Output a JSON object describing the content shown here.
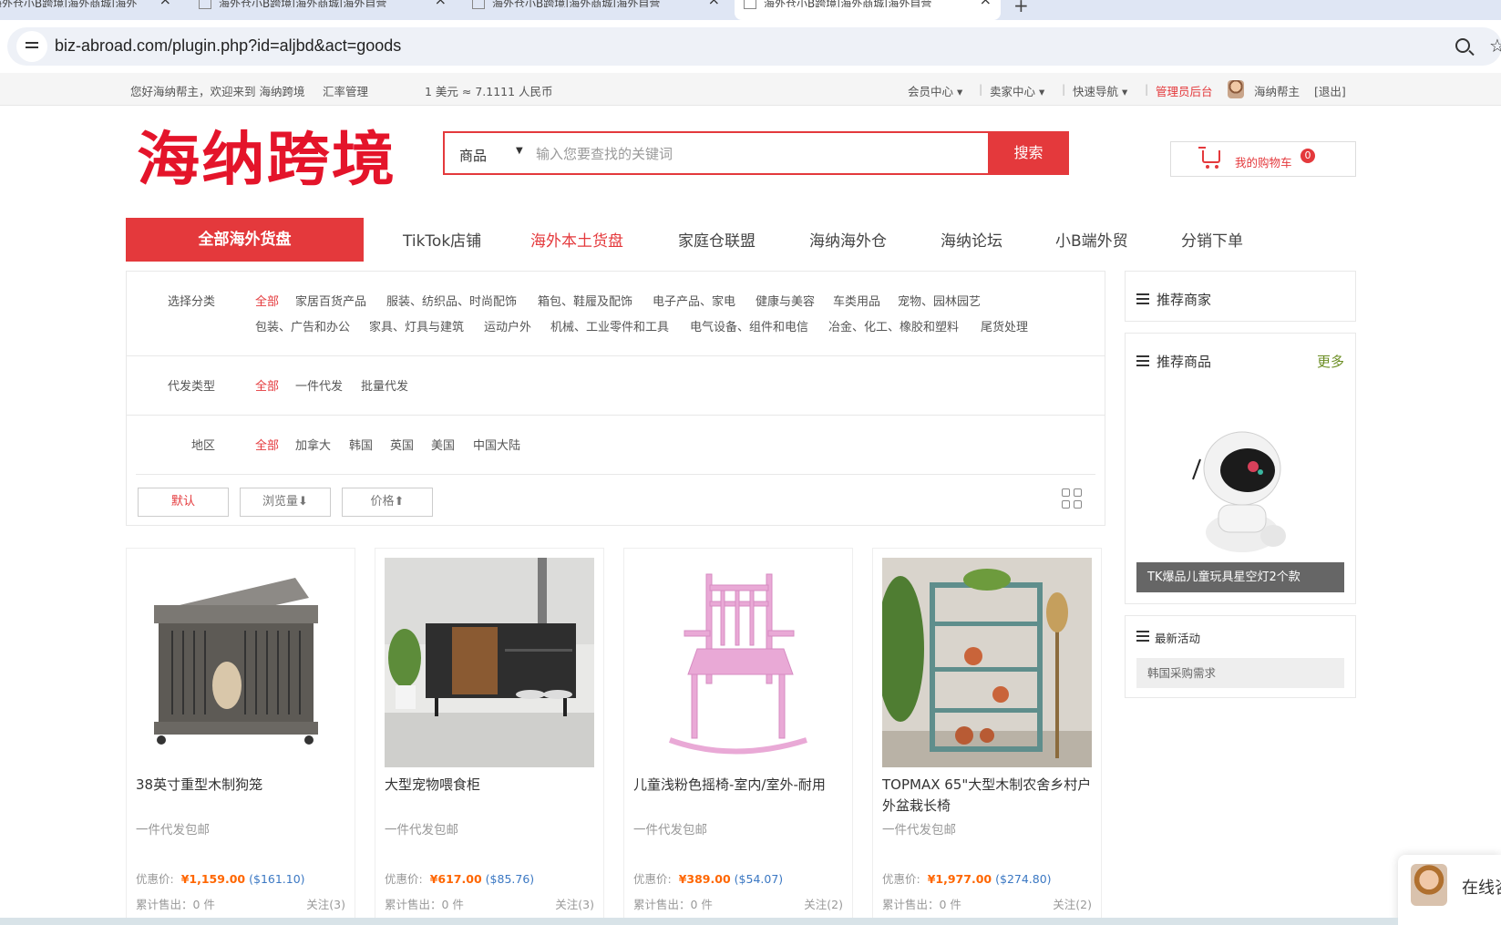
{
  "browser": {
    "tabs": [
      {
        "title": "海外仓小B跨境|海外商城|海外"
      },
      {
        "title": "海外仓小B跨境|海外商城|海外自营"
      },
      {
        "title": "海外仓小B跨境|海外商城|海外自营"
      },
      {
        "title": "海外仓小B跨境|海外商城|海外自营"
      }
    ],
    "url": "biz-abroad.com/plugin.php?id=aljbd&act=goods"
  },
  "topbar": {
    "welcome": "您好海纳帮主，欢迎来到 海纳跨境",
    "rate_mgmt": "汇率管理",
    "rate": "1 美元 ≈ 7.1111 人民币",
    "member_center": "会员中心 ▾",
    "seller_center": "卖家中心 ▾",
    "quick_nav": "快速导航 ▾",
    "admin": "管理员后台",
    "username": "海纳帮主",
    "logout": "[退出]"
  },
  "header": {
    "logo": "海纳跨境",
    "search_type": "商品",
    "search_placeholder": "输入您要查找的关键词",
    "search_button": "搜索",
    "cart_label": "我的购物车",
    "cart_count": "0"
  },
  "nav": {
    "all": "全部海外货盘",
    "links": [
      "TikTok店铺",
      "海外本土货盘",
      "家庭仓联盟",
      "海纳海外仓",
      "海纳论坛",
      "小B端外贸",
      "分销下单"
    ]
  },
  "filter": {
    "category_label": "选择分类",
    "categories_row1": [
      "全部",
      "家居百货产品",
      "服装、纺织品、时尚配饰",
      "箱包、鞋履及配饰",
      "电子产品、家电",
      "健康与美容",
      "车类用品",
      "宠物、园林园艺"
    ],
    "categories_row2": [
      "包装、广告和办公",
      "家具、灯具与建筑",
      "运动户外",
      "机械、工业零件和工具",
      "电气设备、组件和电信",
      "冶金、化工、橡胶和塑料",
      "尾货处理"
    ],
    "type_label": "代发类型",
    "types": [
      "全部",
      "一件代发",
      "批量代发"
    ],
    "region_label": "地区",
    "regions": [
      "全部",
      "加拿大",
      "韩国",
      "英国",
      "美国",
      "中国大陆"
    ],
    "sort": [
      "默认",
      "浏览量⬇",
      "价格⬆"
    ]
  },
  "products": [
    {
      "name": "38英寸重型木制狗笼",
      "tag": "一件代发包邮",
      "price_label": "优惠价:",
      "cny": "¥1,159.00",
      "usd": "($161.10)",
      "sold": "累计售出：0 件",
      "follow": "关注(3)"
    },
    {
      "name": "大型宠物喂食柜",
      "tag": "一件代发包邮",
      "price_label": "优惠价:",
      "cny": "¥617.00",
      "usd": "($85.76)",
      "sold": "累计售出：0 件",
      "follow": "关注(3)"
    },
    {
      "name": "儿童浅粉色摇椅-室内/室外-耐用",
      "tag": "一件代发包邮",
      "price_label": "优惠价:",
      "cny": "¥389.00",
      "usd": "($54.07)",
      "sold": "累计售出：0 件",
      "follow": "关注(2)"
    },
    {
      "name": "TOPMAX 65\"大型木制农舍乡村户外盆栽长椅",
      "tag": "一件代发包邮",
      "price_label": "优惠价:",
      "cny": "¥1,977.00",
      "usd": "($274.80)",
      "sold": "累计售出：0 件",
      "follow": "关注(2)"
    }
  ],
  "sidebar": {
    "merchants_title": "推荐商家",
    "goods_title": "推荐商品",
    "more": "更多",
    "rec_caption": "TK爆品儿童玩具星空灯2个款",
    "activity_title": "最新活动",
    "activity_item": "韩国采购需求"
  },
  "chat": {
    "label": "在线咨询"
  }
}
